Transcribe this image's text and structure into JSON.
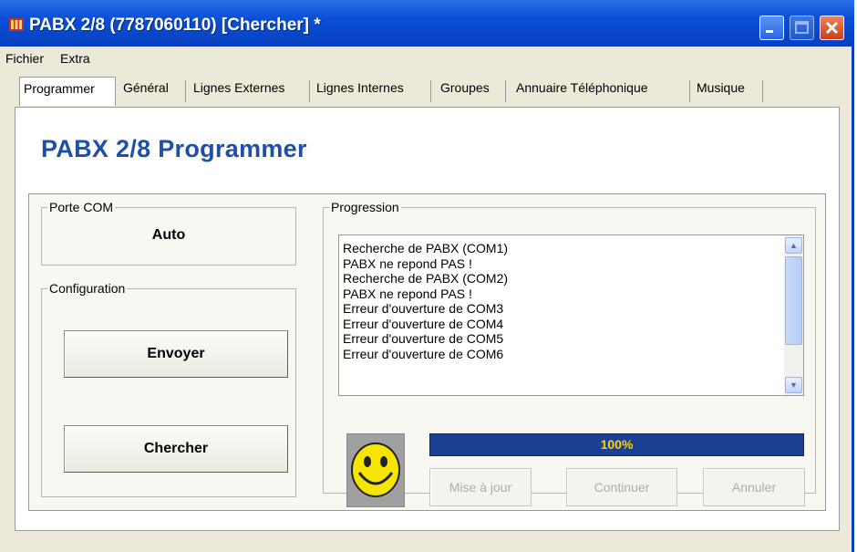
{
  "window": {
    "title": "PABX 2/8 (7787060110) [Chercher] *",
    "controls": [
      "minimize-icon",
      "maximize-icon",
      "close-icon"
    ]
  },
  "menu": [
    "Fichier",
    "Extra"
  ],
  "tabs": [
    {
      "label": "Programmer",
      "active": true
    },
    {
      "label": "Général",
      "active": false
    },
    {
      "label": "Lignes Externes",
      "active": false
    },
    {
      "label": "Lignes Internes",
      "active": false
    },
    {
      "label": "Groupes",
      "active": false
    },
    {
      "label": "Annuaire Téléphonique",
      "active": false
    },
    {
      "label": "Musique",
      "active": false
    }
  ],
  "heading": "PABX 2/8 Programmer",
  "porte_com": {
    "legend": "Porte COM",
    "value": "Auto"
  },
  "configuration": {
    "legend": "Configuration",
    "send_label": "Envoyer",
    "search_label": "Chercher"
  },
  "progression": {
    "legend": "Progression",
    "log": [
      "Recherche de PABX (COM1)",
      "PABX ne repond PAS !",
      "Recherche de PABX (COM2)",
      "PABX ne repond PAS !",
      "Erreur d'ouverture de COM3",
      "Erreur d'ouverture de COM4",
      "Erreur d'ouverture de COM5",
      "Erreur d'ouverture de COM6"
    ],
    "progress_text": "100%",
    "progress_value": 1.0,
    "buttons": {
      "update": "Mise à jour",
      "continue": "Continuer",
      "cancel": "Annuler"
    }
  },
  "colors": {
    "heading": "#1f4fa8",
    "progress_bar": "#1c3f94",
    "progress_text": "#ffd200",
    "smiley": "#f5e500"
  }
}
